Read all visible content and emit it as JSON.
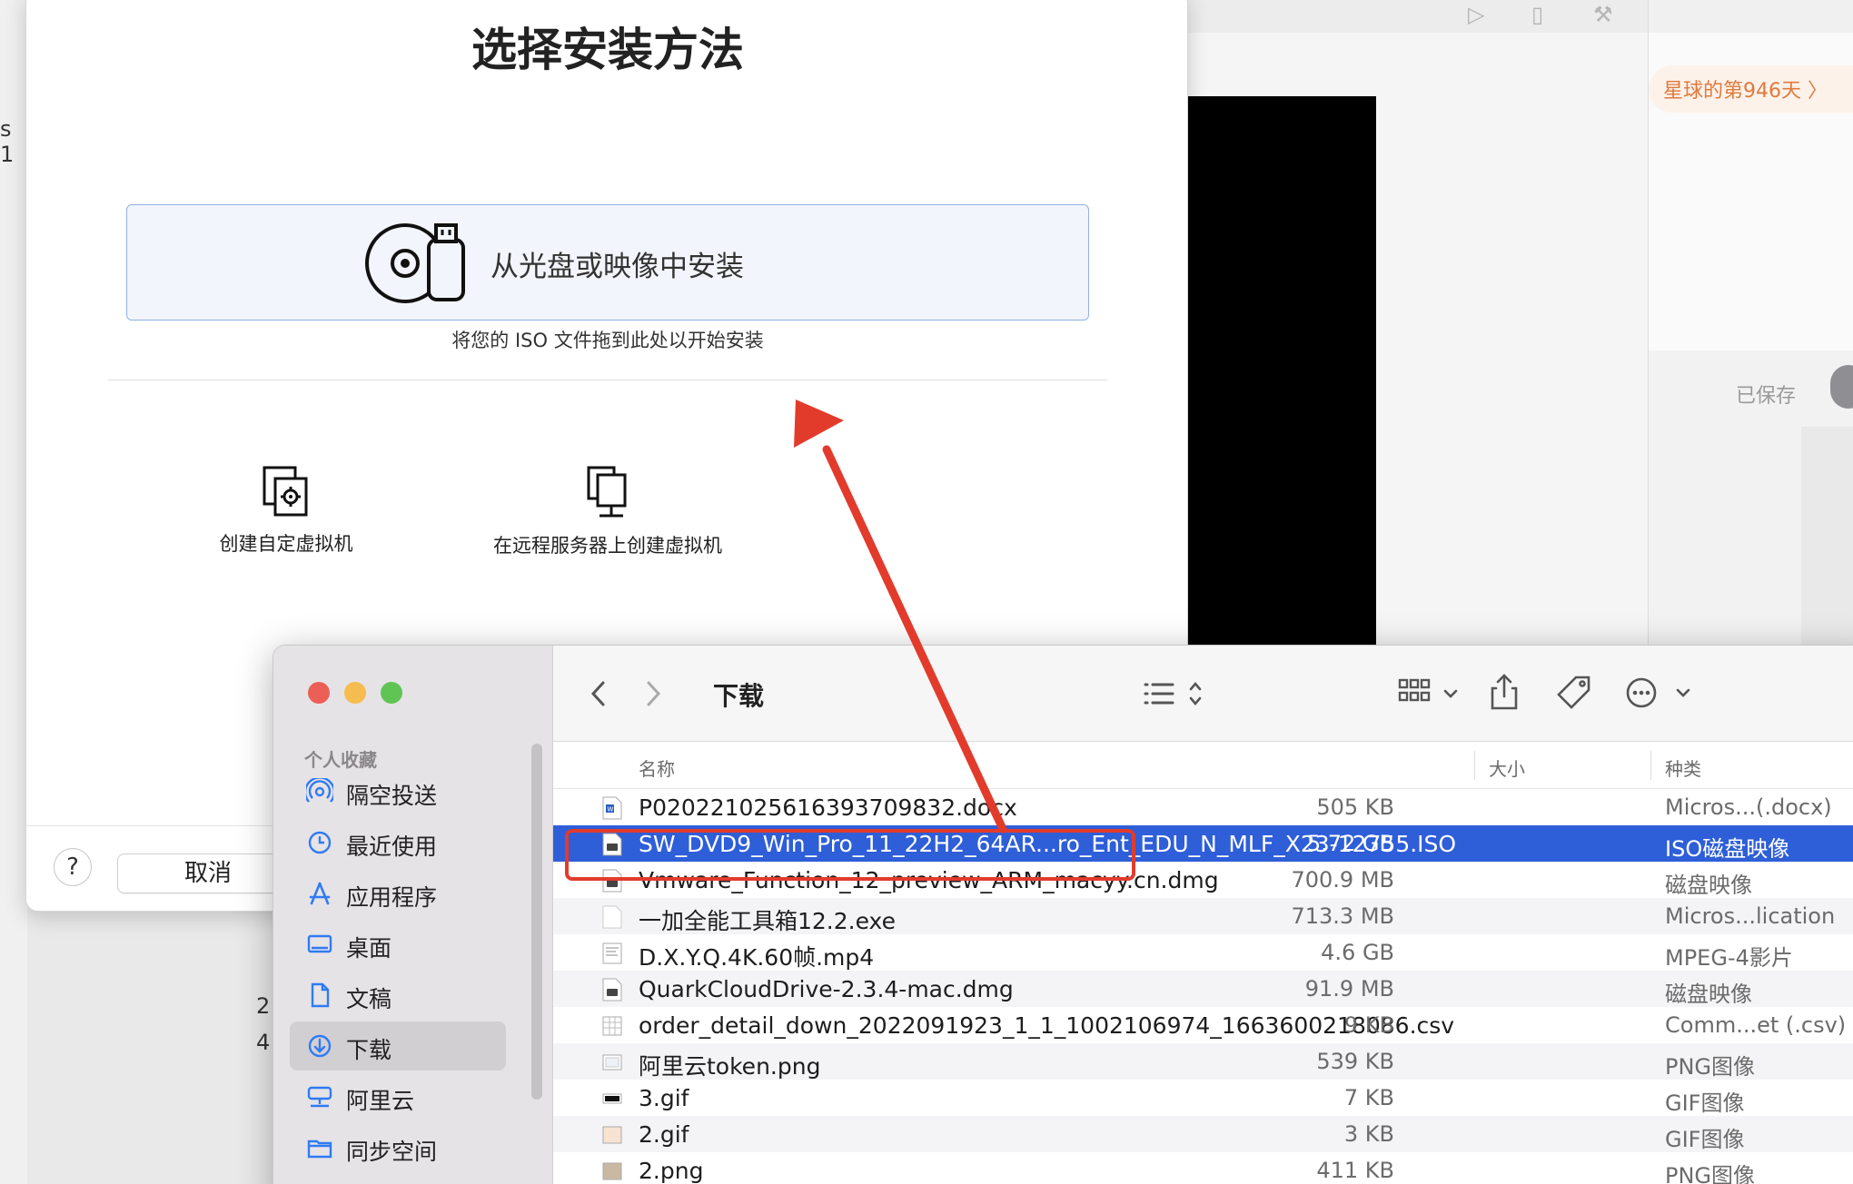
{
  "background_app": {
    "banner_text": "星球的第946天 〉",
    "saved_label": "已保存",
    "left_edge_text": "s 1",
    "left_digits": [
      "2",
      "4"
    ]
  },
  "dialog": {
    "title": "选择安装方法",
    "install_option_label": "从光盘或映像中安装",
    "drag_hint": "将您的 ISO 文件拖到此处以开始安装",
    "options": [
      {
        "label": "创建自定虚拟机",
        "icon": "custom-vm-icon"
      },
      {
        "label": "在远程服务器上创建虚拟机",
        "icon": "remote-server-icon"
      }
    ],
    "help_label": "?",
    "cancel_label": "取消"
  },
  "finder": {
    "title": "下载",
    "sidebar": {
      "section": "个人收藏",
      "items": [
        {
          "label": "隔空投送",
          "icon": "airdrop-icon"
        },
        {
          "label": "最近使用",
          "icon": "clock-icon"
        },
        {
          "label": "应用程序",
          "icon": "apps-icon"
        },
        {
          "label": "桌面",
          "icon": "desktop-icon"
        },
        {
          "label": "文稿",
          "icon": "document-icon"
        },
        {
          "label": "下载",
          "icon": "download-icon",
          "selected": true
        },
        {
          "label": "阿里云",
          "icon": "network-drive-icon"
        },
        {
          "label": "同步空间",
          "icon": "folder-icon"
        }
      ]
    },
    "columns": {
      "name": "名称",
      "size": "大小",
      "kind": "种类"
    },
    "files": [
      {
        "name": "P020221025616393709832.docx",
        "size": "505 KB",
        "kind": "Micros...(.docx)",
        "icon": "word-file-icon"
      },
      {
        "name": "SW_DVD9_Win_Pro_11_22H2_64AR...ro_Ent_EDU_N_MLF_X23-12755.ISO",
        "size": "5.72 GB",
        "kind": "ISO磁盘映像",
        "icon": "disk-image-icon",
        "selected": true
      },
      {
        "name": "Vmware_Function_12_preview_ARM_macyy.cn.dmg",
        "size": "700.9 MB",
        "kind": "磁盘映像",
        "icon": "disk-image-icon"
      },
      {
        "name": "一加全能工具箱12.2.exe",
        "size": "713.3 MB",
        "kind": "Micros...lication",
        "icon": "blank-file-icon"
      },
      {
        "name": "D.X.Y.Q.4K.60帧.mp4",
        "size": "4.6 GB",
        "kind": "MPEG-4影片",
        "icon": "video-file-icon"
      },
      {
        "name": "QuarkCloudDrive-2.3.4-mac.dmg",
        "size": "91.9 MB",
        "kind": "磁盘映像",
        "icon": "disk-image-icon"
      },
      {
        "name": "order_detail_down_2022091923_1_1_1002106974_1663600218086.csv",
        "size": "9 KB",
        "kind": "Comm...et (.csv)",
        "icon": "csv-file-icon"
      },
      {
        "name": "阿里云token.png",
        "size": "539 KB",
        "kind": "PNG图像",
        "icon": "image-file-icon"
      },
      {
        "name": "3.gif",
        "size": "7 KB",
        "kind": "GIF图像",
        "icon": "gif-file-icon"
      },
      {
        "name": "2.gif",
        "size": "3 KB",
        "kind": "GIF图像",
        "icon": "gif-file-icon"
      },
      {
        "name": "2.png",
        "size": "411 KB",
        "kind": "PNG图像",
        "icon": "image-file-icon"
      }
    ]
  },
  "colors": {
    "selection": "#2e5ed8",
    "annotation_red": "#e23b2c",
    "install_box_border": "#8fb2e6",
    "traffic_red": "#ec5f57",
    "traffic_yellow": "#f5bd4f",
    "traffic_green": "#5fc454"
  }
}
